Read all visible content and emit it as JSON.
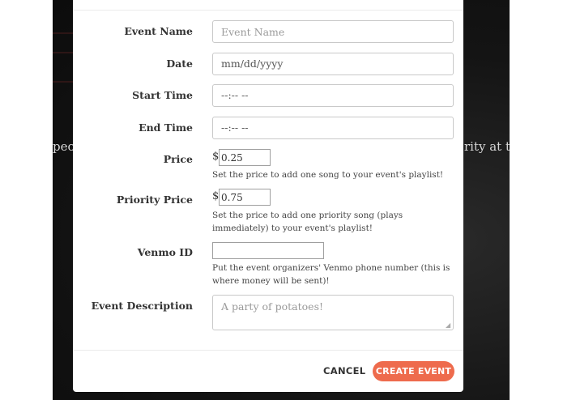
{
  "background": {
    "left_text": "peop",
    "right_text": "rity at th"
  },
  "form": {
    "event_name": {
      "label": "Event Name",
      "placeholder": "Event Name"
    },
    "date": {
      "label": "Date",
      "placeholder": "mm/dd/yyyy"
    },
    "start_time": {
      "label": "Start Time",
      "placeholder": "--:-- --"
    },
    "end_time": {
      "label": "End Time",
      "placeholder": "--:-- --"
    },
    "price": {
      "label": "Price",
      "currency": "$",
      "value": "0.25",
      "help": "Set the price to add one song to your event's playlist!"
    },
    "priority_price": {
      "label": "Priority Price",
      "currency": "$",
      "value": "0.75",
      "help": "Set the price to add one priority song (plays immediately) to your event's playlist!"
    },
    "venmo_id": {
      "label": "Venmo ID",
      "value": "",
      "help": "Put the event organizers' Venmo phone number (this is where money will be sent)!"
    },
    "event_description": {
      "label": "Event Description",
      "placeholder": "A party of potatoes!"
    }
  },
  "footer": {
    "cancel_label": "CANCEL",
    "create_label": "CREATE EVENT"
  },
  "colors": {
    "accent": "#ee6b4d"
  }
}
